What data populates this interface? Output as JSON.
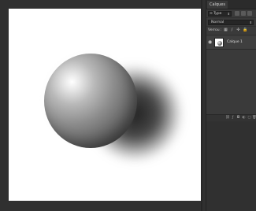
{
  "layers_panel": {
    "tab_title": "Calques",
    "filter_select": "Type",
    "blend_mode": "Normal",
    "lock_label": "Verrou :",
    "layer_name": "Calque 1"
  },
  "icons": {
    "filter": "⊖",
    "chevron": "⬍",
    "eye": "◉",
    "lock_pixels": "▦",
    "lock_brush": "∕",
    "lock_move": "✣",
    "lock_all": "🔒"
  },
  "colors": {
    "canvas_bg": "#303030",
    "document_bg": "#ffffff",
    "panel_bg": "#3a3a3a"
  }
}
